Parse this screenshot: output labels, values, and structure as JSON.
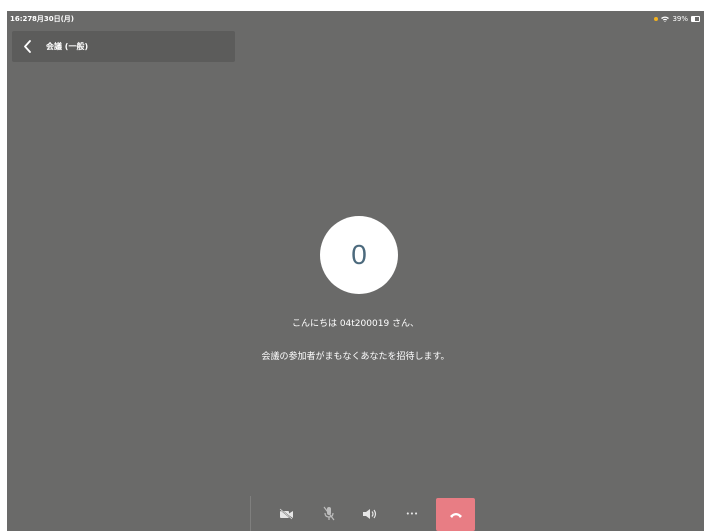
{
  "status_bar": {
    "time": "16:27",
    "date": "8月30日(月)",
    "battery_text": "39%",
    "indicator_color": "#f3b11e"
  },
  "header": {
    "title": "会議 (一般)",
    "back_icon": "chevron-left-icon"
  },
  "avatar": {
    "text": "0"
  },
  "messages": {
    "greeting": "こんにちは 04t200019 さん、",
    "invite": "会議の参加者がまもなくあなたを招待します。"
  },
  "controls": {
    "icons": [
      "camera-off-icon",
      "mic-off-icon",
      "speaker-icon",
      "more-icon",
      "hangup-icon"
    ],
    "more_label": "•••",
    "hangup_color": "#e87d84"
  },
  "colors": {
    "background": "#6a6a69",
    "header": "#5c5c5b",
    "avatar_text": "#4c6a7d"
  }
}
